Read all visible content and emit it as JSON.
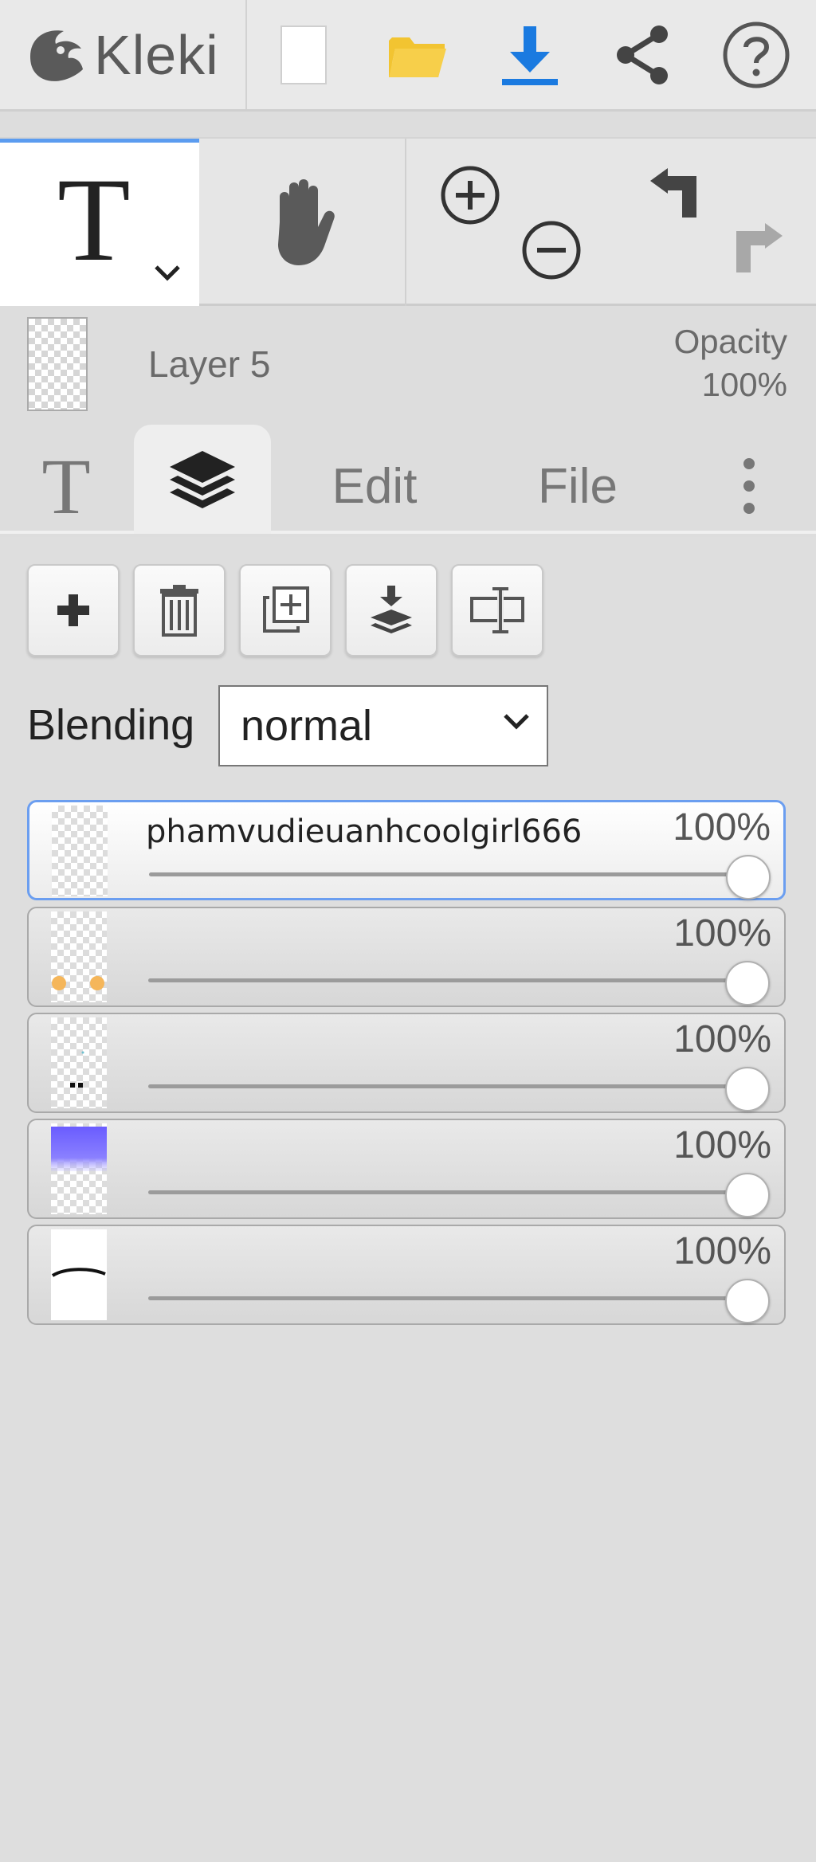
{
  "app": {
    "name": "Kleki"
  },
  "topbar": {
    "buttons": [
      "new-image",
      "open-file",
      "save-download",
      "share",
      "help"
    ]
  },
  "toolbar": {
    "tools": [
      "text",
      "hand"
    ],
    "active_tool": "text",
    "actions": [
      "zoom-in",
      "zoom-out",
      "undo",
      "redo"
    ]
  },
  "layer_info": {
    "name": "Layer 5",
    "opacity_label": "Opacity",
    "opacity_value": "100%"
  },
  "tabs": {
    "edit": "Edit",
    "file": "File",
    "active": "layers"
  },
  "layer_panel": {
    "buttons": [
      "add-layer",
      "delete-layer",
      "duplicate-layer",
      "merge-down",
      "rename-layer"
    ],
    "blending_label": "Blending",
    "blending_value": "normal",
    "layers": [
      {
        "name": "phamvudieuanhcoolgirl666",
        "opacity": "100%",
        "opacity_fraction": 1.0,
        "active": true
      },
      {
        "name": "",
        "opacity": "100%",
        "opacity_fraction": 1.0,
        "active": false
      },
      {
        "name": "",
        "opacity": "100%",
        "opacity_fraction": 1.0,
        "active": false
      },
      {
        "name": "",
        "opacity": "100%",
        "opacity_fraction": 1.0,
        "active": false
      },
      {
        "name": "",
        "opacity": "100%",
        "opacity_fraction": 1.0,
        "active": false
      }
    ]
  },
  "colors": {
    "accent": "#5b9cf0",
    "download_icon": "#1a7ae0",
    "folder_icon": "#f2c431",
    "layer_thumb_purple": "#7a6cff",
    "layer_thumb_orange": "#f5b65a"
  }
}
